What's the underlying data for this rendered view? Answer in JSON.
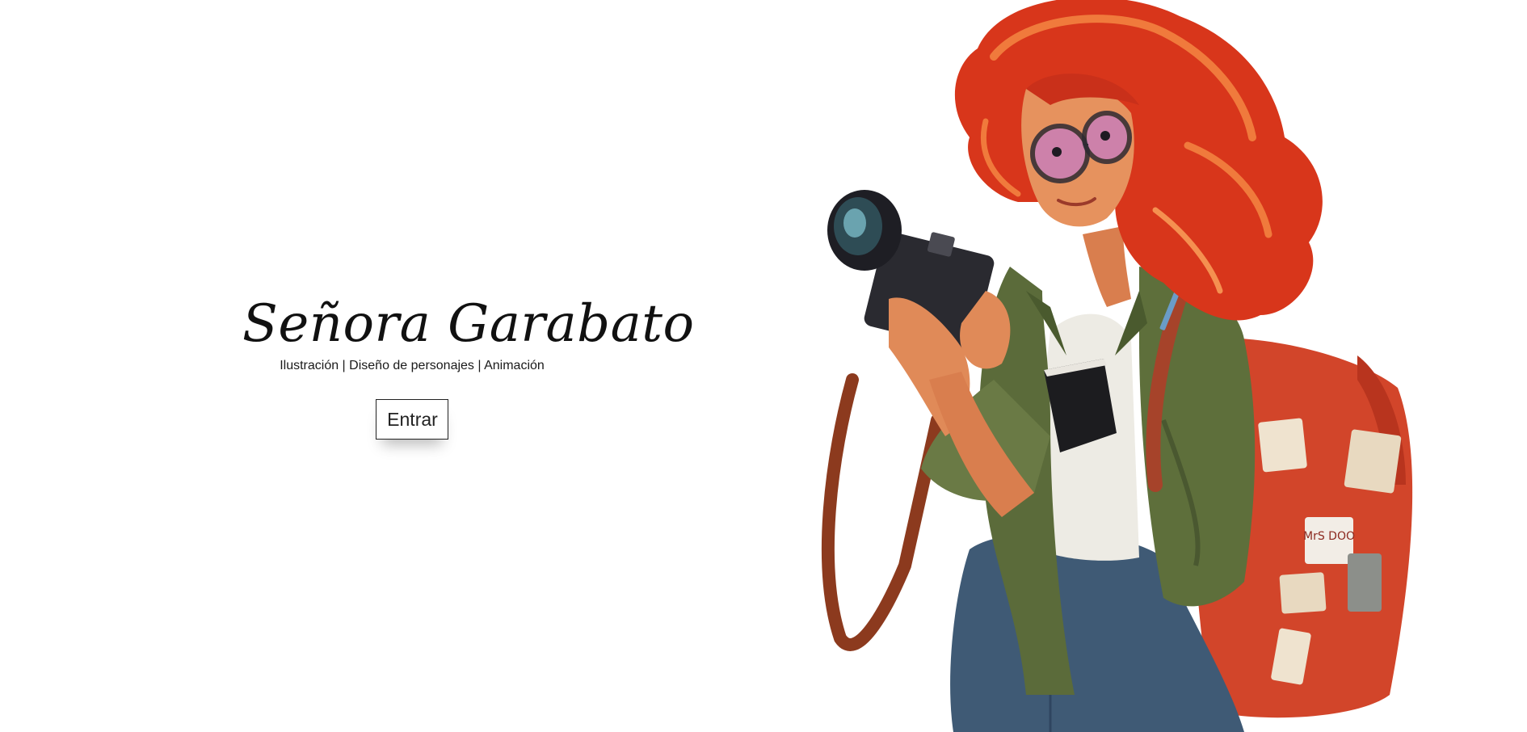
{
  "hero": {
    "title": "Señora Garabato",
    "tagline": "Ilustración | Diseño de personajes | Animación",
    "enter_label": "Entrar"
  },
  "illustration": {
    "subject": "red-haired-photographer-illustration",
    "badge_text": "MrS DOO",
    "colors": {
      "hair": "#D8361B",
      "hair_highlight": "#F07A3C",
      "skin": "#E6925E",
      "jacket": "#5B6B3A",
      "jeans": "#3F5A75",
      "backpack": "#D2452A",
      "camera": "#2A2A30"
    }
  }
}
